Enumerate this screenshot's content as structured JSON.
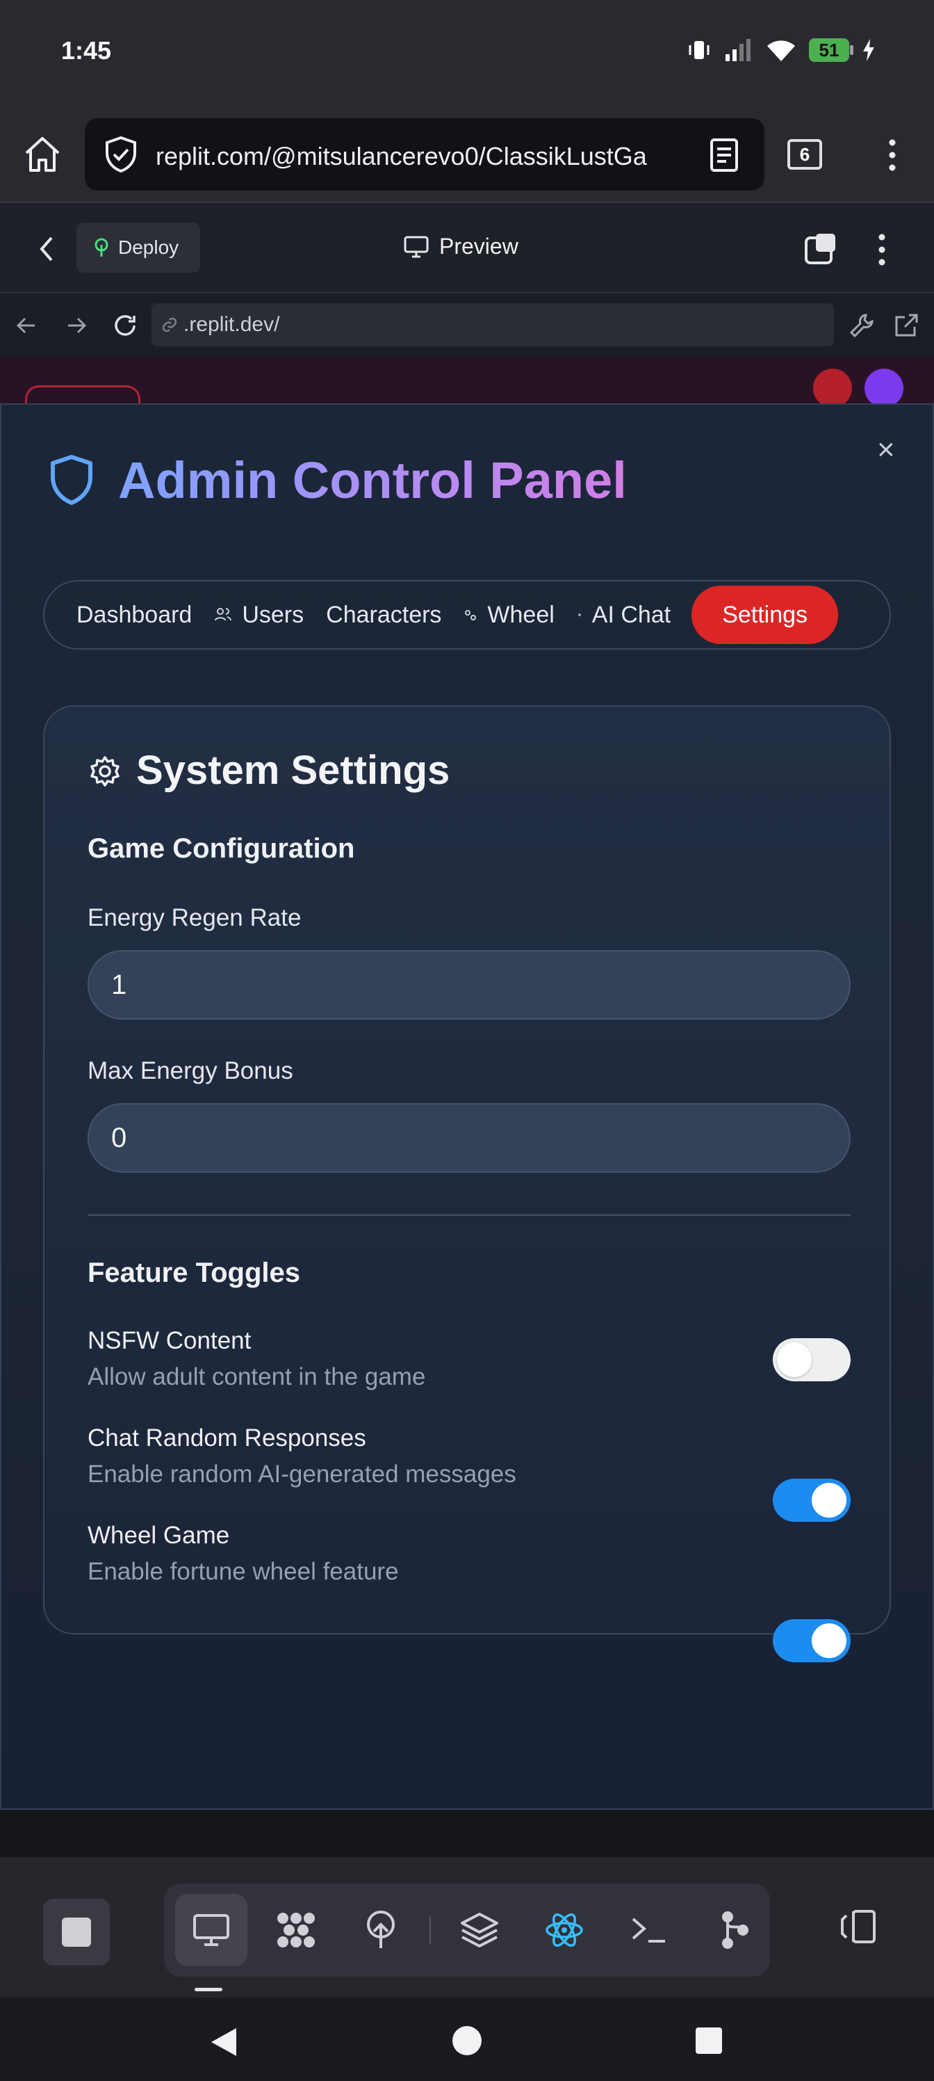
{
  "status_bar": {
    "time": "1:45",
    "battery": "51"
  },
  "browser": {
    "url": "replit.com/@mitsulancerevo0/ClassikLustGa",
    "tab_count": "6"
  },
  "replit": {
    "deploy_label": "Deploy",
    "preview_label": "Preview",
    "preview_url": ".replit.dev/"
  },
  "modal": {
    "title": "Admin Control Panel",
    "close": "×",
    "tabs": [
      "Dashboard",
      "Users",
      "Characters",
      "Wheel",
      "AI Chat",
      "Settings"
    ],
    "active_tab": "Settings",
    "settings": {
      "heading": "System Settings",
      "game_config": {
        "heading": "Game Configuration",
        "energy_regen_label": "Energy Regen Rate",
        "energy_regen_value": "1",
        "max_energy_label": "Max Energy Bonus",
        "max_energy_value": "0"
      },
      "feature_toggles": {
        "heading": "Feature Toggles",
        "items": [
          {
            "title": "NSFW Content",
            "desc": "Allow adult content in the game",
            "on": false
          },
          {
            "title": "Chat Random Responses",
            "desc": "Enable random AI-generated messages",
            "on": true
          },
          {
            "title": "Wheel Game",
            "desc": "Enable fortune wheel feature",
            "on": true
          }
        ]
      }
    }
  },
  "colors": {
    "accent": "#dc2626",
    "toggle_on": "#1d8cf0",
    "title_start": "#7ea2ff",
    "title_end": "#d17ee6"
  }
}
